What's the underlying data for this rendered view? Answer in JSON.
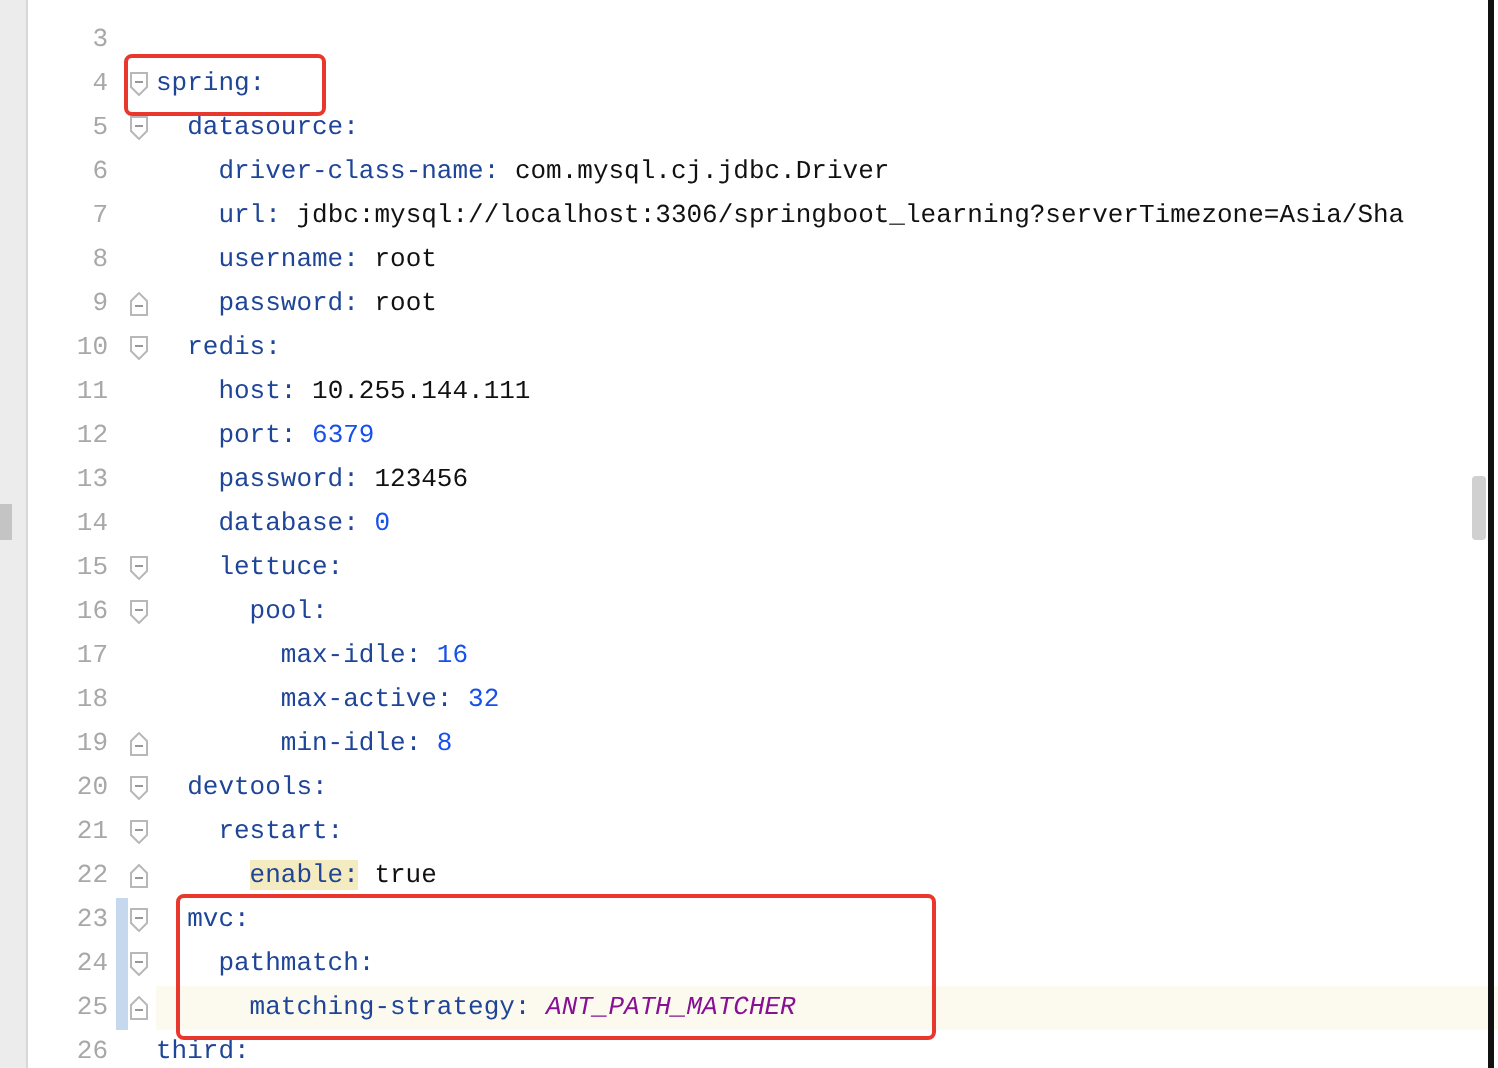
{
  "editor": {
    "blank_lines": [
      {
        "number": "3"
      }
    ],
    "entries": [
      {
        "number": "4",
        "key": "spring:",
        "boxed": true,
        "children": [
          {
            "number": "5",
            "key": "datasource:",
            "children": [
              {
                "number": "6",
                "key": "driver-class-name:",
                "value": "com.mysql.cj.jdbc.Driver",
                "kind": "text"
              },
              {
                "number": "7",
                "key": "url:",
                "value": "jdbc:mysql://localhost:3306/springboot_learning?serverTimezone=Asia/Sha",
                "kind": "text"
              },
              {
                "number": "8",
                "key": "username:",
                "value": "root",
                "kind": "text"
              },
              {
                "number": "9",
                "key": "password:",
                "value": "root",
                "kind": "text"
              }
            ]
          },
          {
            "number": "10",
            "key": "redis:",
            "children": [
              {
                "number": "11",
                "key": "host:",
                "value": "10.255.144.111",
                "kind": "text"
              },
              {
                "number": "12",
                "key": "port:",
                "value": "6379",
                "kind": "number"
              },
              {
                "number": "13",
                "key": "password:",
                "value": "123456",
                "kind": "text"
              },
              {
                "number": "14",
                "key": "database:",
                "value": "0",
                "kind": "number"
              },
              {
                "number": "15",
                "key": "lettuce:",
                "children": [
                  {
                    "number": "16",
                    "key": "pool:",
                    "children": [
                      {
                        "number": "17",
                        "key": "max-idle:",
                        "value": "16",
                        "kind": "number"
                      },
                      {
                        "number": "18",
                        "key": "max-active:",
                        "value": "32",
                        "kind": "number"
                      },
                      {
                        "number": "19",
                        "key": "min-idle:",
                        "value": "8",
                        "kind": "number"
                      }
                    ]
                  }
                ]
              }
            ]
          },
          {
            "number": "20",
            "key": "devtools:",
            "children": [
              {
                "number": "21",
                "key": "restart:",
                "children": [
                  {
                    "number": "22",
                    "key": "enable:",
                    "value": "true",
                    "kind": "text",
                    "key_highlighted": true
                  }
                ]
              }
            ]
          },
          {
            "number": "23",
            "key": "mvc:",
            "boxed": true,
            "changed": true,
            "children": [
              {
                "number": "24",
                "key": "pathmatch:",
                "boxed": true,
                "changed": true,
                "children": [
                  {
                    "number": "25",
                    "key": "matching-strategy:",
                    "value": "ANT_PATH_MATCHER",
                    "kind": "constant",
                    "boxed": true,
                    "changed": true,
                    "current": true
                  }
                ]
              }
            ]
          }
        ]
      },
      {
        "number": "26",
        "key": "third:"
      }
    ]
  }
}
